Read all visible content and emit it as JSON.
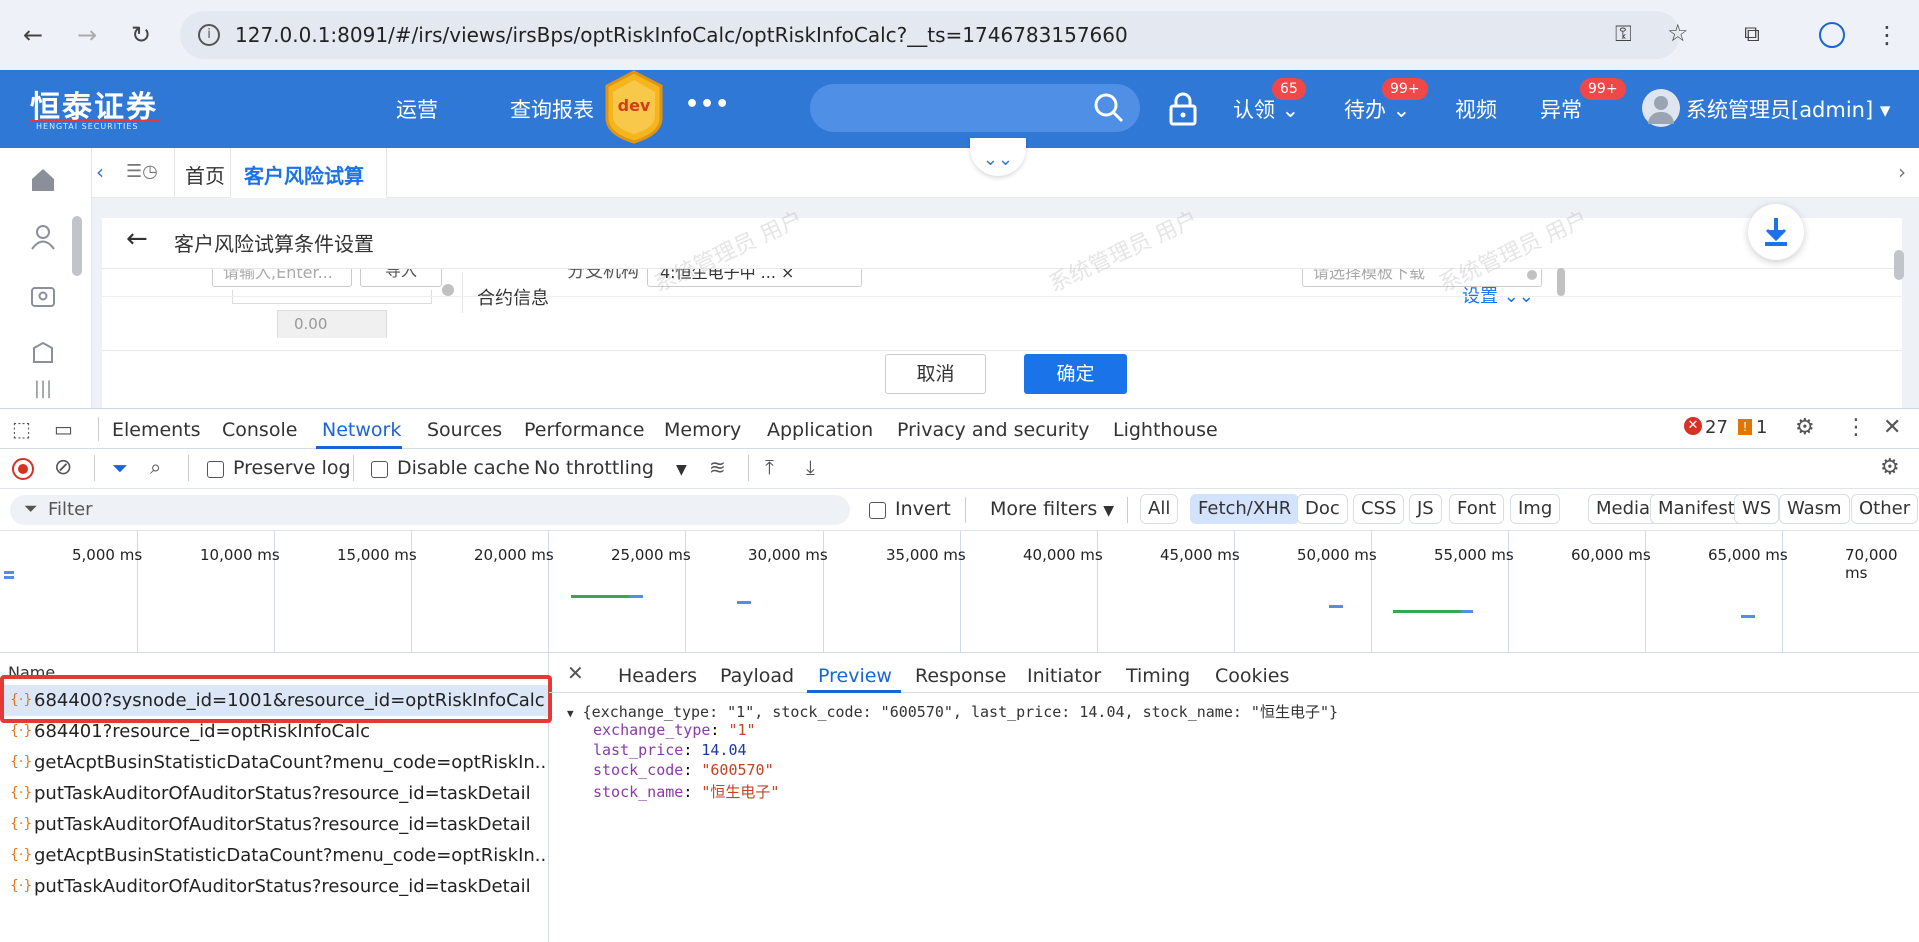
{
  "browser": {
    "url": "127.0.0.1:8091/#/irs/views/irsBps/optRiskInfoCalc/optRiskInfoCalc?__ts=1746783157660"
  },
  "app_header": {
    "logo_text": "恒泰证券",
    "logo_sub": "HENGTAI SECURITIES",
    "menu": [
      "运营",
      "查询报表"
    ],
    "env_badge": "dev",
    "more": "•••",
    "actions": [
      {
        "label": "认领",
        "badge": "65"
      },
      {
        "label": "待办",
        "badge": "99+"
      },
      {
        "label": "视频",
        "badge": ""
      },
      {
        "label": "异常",
        "badge": "99+"
      }
    ],
    "user": "系统管理员[admin]"
  },
  "tabs": {
    "items": [
      "首页",
      "客户风险试算"
    ],
    "active": "客户风险试算"
  },
  "page": {
    "title": "客户风险试算条件设置",
    "input_placeholder": "请输入,Enter...",
    "import_btn": "导入",
    "branch_label": "分支机构",
    "branch_value": "4:恒生电子中 ... ×",
    "template_placeholder": "请选择模板下载",
    "amount_placeholder": "0.00",
    "section_title": "合约信息",
    "settings_link": "设置",
    "cancel": "取消",
    "confirm": "确定",
    "watermark": "系统管理员 用户"
  },
  "devtools": {
    "tabs": [
      "Elements",
      "Console",
      "Network",
      "Sources",
      "Performance",
      "Memory",
      "Application",
      "Privacy and security",
      "Lighthouse"
    ],
    "active_tab": "Network",
    "errors": "27",
    "warnings": "1",
    "toolbar": {
      "preserve_log": "Preserve log",
      "disable_cache": "Disable cache",
      "throttling": "No throttling"
    },
    "filter": {
      "placeholder": "Filter",
      "invert": "Invert",
      "more_filters": "More filters",
      "types": [
        "All",
        "Fetch/XHR",
        "Doc",
        "CSS",
        "JS",
        "Font",
        "Img",
        "Media",
        "Manifest",
        "WS",
        "Wasm",
        "Other"
      ],
      "active_type": "Fetch/XHR"
    },
    "timeline_ticks": [
      "5,000 ms",
      "10,000 ms",
      "15,000 ms",
      "20,000 ms",
      "25,000 ms",
      "30,000 ms",
      "35,000 ms",
      "40,000 ms",
      "45,000 ms",
      "50,000 ms",
      "55,000 ms",
      "60,000 ms",
      "65,000 ms",
      "70,000 ms"
    ],
    "name_header": "Name",
    "requests": [
      "684400?sysnode_id=1001&resource_id=optRiskInfoCalc",
      "684401?resource_id=optRiskInfoCalc",
      "getAcptBusinStatisticDataCount?menu_code=optRiskIn......",
      "putTaskAuditorOfAuditorStatus?resource_id=taskDetail",
      "putTaskAuditorOfAuditorStatus?resource_id=taskDetail",
      "getAcptBusinStatisticDataCount?menu_code=optRiskIn......",
      "putTaskAuditorOfAuditorStatus?resource_id=taskDetail"
    ],
    "detail_tabs": [
      "Headers",
      "Payload",
      "Preview",
      "Response",
      "Initiator",
      "Timing",
      "Cookies"
    ],
    "detail_active": "Preview",
    "preview": {
      "summary": "{exchange_type: \"1\", stock_code: \"600570\", last_price: 14.04, stock_name: \"恒生电子\"}",
      "fields": [
        {
          "key": "exchange_type",
          "value": "\"1\"",
          "kind": "s"
        },
        {
          "key": "last_price",
          "value": "14.04",
          "kind": "n"
        },
        {
          "key": "stock_code",
          "value": "\"600570\"",
          "kind": "s"
        },
        {
          "key": "stock_name",
          "value": "\"恒生电子\"",
          "kind": "s"
        }
      ]
    }
  },
  "colors": {
    "brand_blue": "#2f78d6",
    "accent_blue": "#1a73e8",
    "highlight_red": "#e53935"
  }
}
